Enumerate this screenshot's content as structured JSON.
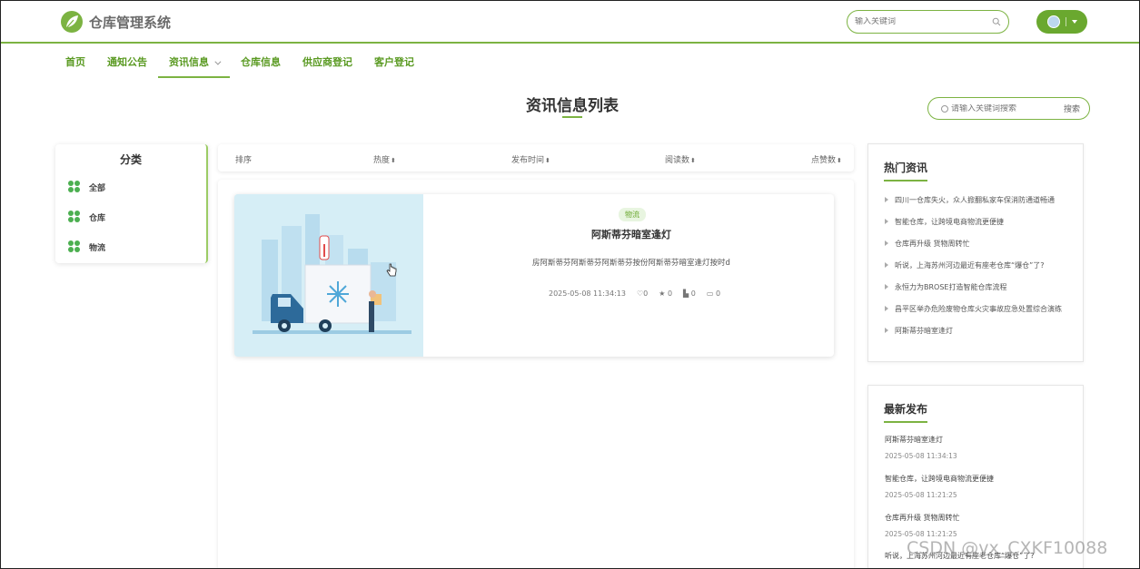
{
  "app": {
    "title": "仓库管理系统"
  },
  "top_search": {
    "placeholder": "输入关键词"
  },
  "nav": {
    "items": [
      {
        "label": "首页"
      },
      {
        "label": "通知公告"
      },
      {
        "label": "资讯信息"
      },
      {
        "label": "仓库信息"
      },
      {
        "label": "供应商登记"
      },
      {
        "label": "客户登记"
      }
    ]
  },
  "page": {
    "title": "资讯信息列表",
    "search_placeholder": "请输入关键词搜索",
    "search_button": "搜索"
  },
  "category": {
    "title": "分类",
    "items": [
      {
        "label": "全部"
      },
      {
        "label": "仓库"
      },
      {
        "label": "物流"
      }
    ]
  },
  "sort": {
    "label": "排序",
    "options": [
      {
        "label": "热度"
      },
      {
        "label": "发布时间"
      },
      {
        "label": "阅读数"
      },
      {
        "label": "点赞数"
      }
    ]
  },
  "news": [
    {
      "tag": "物流",
      "title": "阿斯蒂芬暗室逢灯",
      "desc": "房阿斯蒂芬阿斯蒂芬阿斯蒂芬按份阿斯蒂芬暗室逢灯按时d",
      "time": "2025-05-08 11:34:13",
      "likes": "0",
      "stars": "0",
      "collects": "0",
      "comments": "0"
    }
  ],
  "hot": {
    "title": "热门资讯",
    "items": [
      "四川一仓库失火，众人掀翻私家车保消防通道畅通",
      "智能仓库，让跨境电商物流更便捷",
      "仓库再升级 货物周转忙",
      "听说，上海苏州河边最近有座老仓库“爆仓”了?",
      "永恒力为BROSE打造智能仓库流程",
      "昌平区举办危险废物仓库火灾事故应急处置综合演练",
      "阿斯蒂芬暗室逢灯"
    ]
  },
  "latest": {
    "title": "最新发布",
    "items": [
      {
        "title": "阿斯蒂芬暗室逢灯",
        "date": "2025-05-08 11:34:13"
      },
      {
        "title": "智能仓库，让跨境电商物流更便捷",
        "date": "2025-05-08 11:21:25"
      },
      {
        "title": "仓库再升级 货物周转忙",
        "date": "2025-05-08 11:21:25"
      },
      {
        "title": "听说，上海苏州河边最近有座老仓库“爆仓”了?",
        "date": ""
      }
    ]
  },
  "watermark": "CSDN @vx_CXKF10088",
  "colors": {
    "accent": "#7cb342",
    "accent_dark": "#6aa82f",
    "nav_text": "#5a9a22"
  },
  "icons": [
    "leaf-logo-icon",
    "search-icon",
    "clover-icon",
    "like-icon",
    "star-icon",
    "collect-icon",
    "comment-icon"
  ]
}
